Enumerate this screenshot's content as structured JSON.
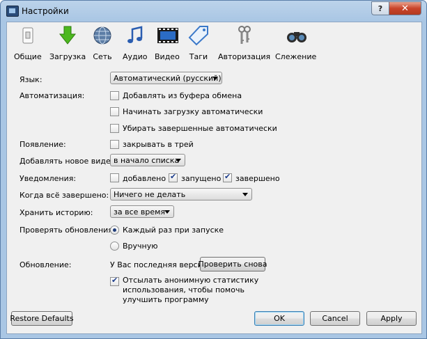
{
  "window": {
    "title": "Настройки",
    "help_label": "?",
    "close_label": "✕"
  },
  "toolbar": [
    {
      "label": "Общие",
      "icon": "general-icon"
    },
    {
      "label": "Загрузка",
      "icon": "download-arrow-icon"
    },
    {
      "label": "Сеть",
      "icon": "network-globe-icon"
    },
    {
      "label": "Аудио",
      "icon": "music-note-icon"
    },
    {
      "label": "Видео",
      "icon": "film-strip-icon"
    },
    {
      "label": "Таги",
      "icon": "tag-icon"
    },
    {
      "label": "Авторизация",
      "icon": "keys-icon"
    },
    {
      "label": "Слежение",
      "icon": "binoculars-icon"
    }
  ],
  "settings": {
    "language": {
      "label": "Язык:",
      "value": "Автоматический (русский)"
    },
    "automation": {
      "label": "Автоматизация:",
      "options": [
        {
          "text": "Добавлять из буфера обмена",
          "checked": false
        },
        {
          "text": "Начинать загрузку автоматически",
          "checked": false
        },
        {
          "text": "Убирать завершенные автоматически",
          "checked": false
        }
      ]
    },
    "appearance": {
      "label": "Появление:",
      "option": {
        "text": "закрывать в трей",
        "checked": false
      }
    },
    "add_video": {
      "label": "Добавлять новое видео:",
      "value": "в начало списка"
    },
    "notifications": {
      "label": "Уведомления:",
      "options": [
        {
          "text": "добавлено",
          "checked": false
        },
        {
          "text": "запущено",
          "checked": true
        },
        {
          "text": "завершено",
          "checked": true
        }
      ]
    },
    "when_done": {
      "label": "Когда всё завершено:",
      "value": "Ничего не делать"
    },
    "history": {
      "label": "Хранить историю:",
      "value": "за все время"
    },
    "check_updates": {
      "label": "Проверять обновления:",
      "options": [
        {
          "text": "Каждый раз при запуске",
          "selected": true
        },
        {
          "text": "Вручную",
          "selected": false
        }
      ]
    },
    "update": {
      "label": "Обновление:",
      "status": "У Вас последняя версия",
      "button": "Проверить снова",
      "stats_text_lines": [
        "Отсылать анонимную статистику",
        "использования, чтобы помочь",
        "улучшить программу"
      ],
      "stats_checked": true
    }
  },
  "buttons": {
    "restore": "Restore Defaults",
    "ok": "OK",
    "cancel": "Cancel",
    "apply": "Apply"
  },
  "colors": {
    "accent": "#3c7fb1",
    "frame": "#a9c6e4",
    "close": "#c9442a",
    "panel": "#f0f0f0"
  }
}
